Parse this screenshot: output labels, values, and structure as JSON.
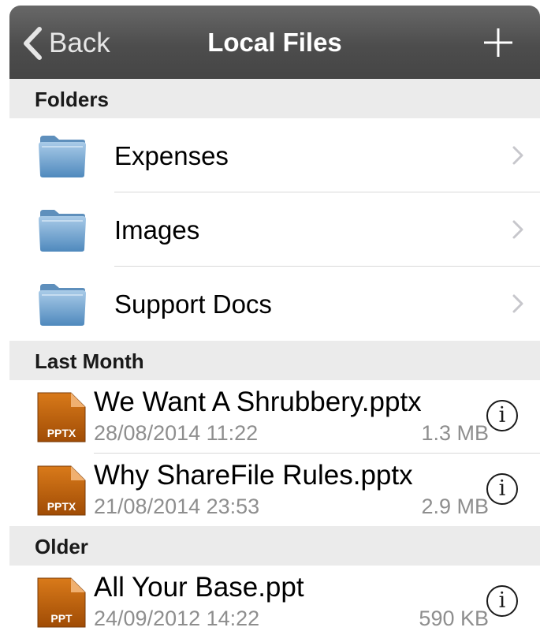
{
  "navbar": {
    "back_label": "Back",
    "title": "Local Files",
    "add_icon": "plus-icon"
  },
  "sections": {
    "folders": {
      "header": "Folders"
    },
    "last_month": {
      "header": "Last Month"
    },
    "older": {
      "header": "Older"
    }
  },
  "folders": [
    {
      "name": "Expenses",
      "icon": "folder-icon"
    },
    {
      "name": "Images",
      "icon": "folder-icon"
    },
    {
      "name": "Support Docs",
      "icon": "folder-icon"
    }
  ],
  "files": [
    {
      "name": "We Want A Shrubbery.pptx",
      "date": "28/08/2014 11:22",
      "size": "1.3 MB",
      "type_label": "PPTX"
    },
    {
      "name": "Why ShareFile Rules.pptx",
      "date": "21/08/2014 23:53",
      "size": "2.9 MB",
      "type_label": "PPTX"
    },
    {
      "name": "All Your Base.ppt",
      "date": "24/09/2012 14:22",
      "size": "590 KB",
      "type_label": "PPT"
    }
  ],
  "info_glyph": "i",
  "colors": {
    "navbar": "#4d4d4d",
    "section_header": "#ebebeb",
    "folder_blue": "#6fa3d0",
    "ppt_orange": "#c8660a",
    "secondary_text": "#8e8e8e"
  }
}
